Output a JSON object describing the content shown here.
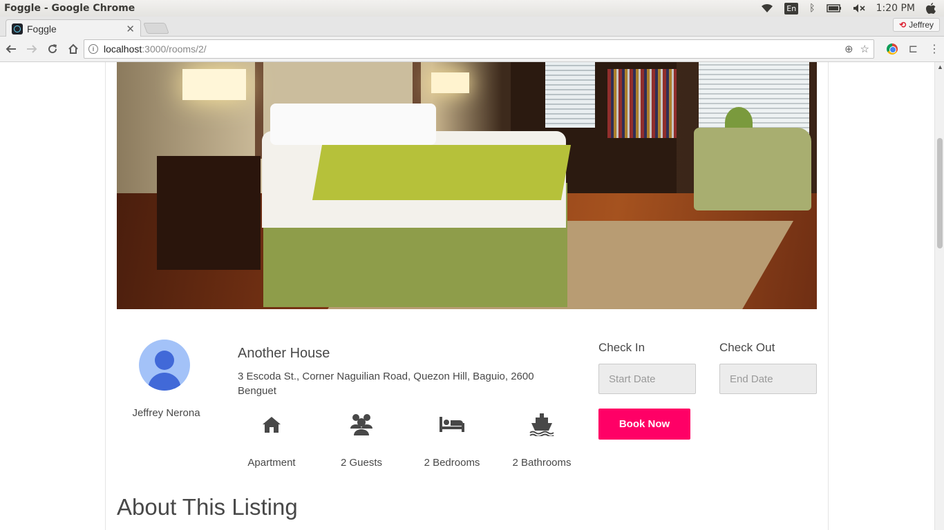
{
  "os": {
    "window_title": "Foggle - Google Chrome",
    "keyboard_layout": "En",
    "time": "1:20 PM"
  },
  "browser": {
    "tab_title": "Foggle",
    "profile_name": "Jeffrey",
    "url_host": "localhost",
    "url_path": ":3000/rooms/2/"
  },
  "host": {
    "name": "Jeffrey Nerona"
  },
  "listing": {
    "title": "Another House",
    "address": "3 Escoda St., Corner Naguilian Road, Quezon Hill, Baguio, 2600 Benguet",
    "features": [
      {
        "icon": "home-icon",
        "label": "Apartment"
      },
      {
        "icon": "guests-icon",
        "label": "2 Guests"
      },
      {
        "icon": "bed-icon",
        "label": "2 Bedrooms"
      },
      {
        "icon": "ship-icon",
        "label": "2 Bathrooms"
      }
    ]
  },
  "booking": {
    "check_in_label": "Check In",
    "check_out_label": "Check Out",
    "start_placeholder": "Start Date",
    "end_placeholder": "End Date",
    "book_label": "Book Now"
  },
  "about": {
    "heading": "About This Listing"
  },
  "colors": {
    "accent": "#ff0066",
    "text": "#484848",
    "icon": "#484848"
  }
}
